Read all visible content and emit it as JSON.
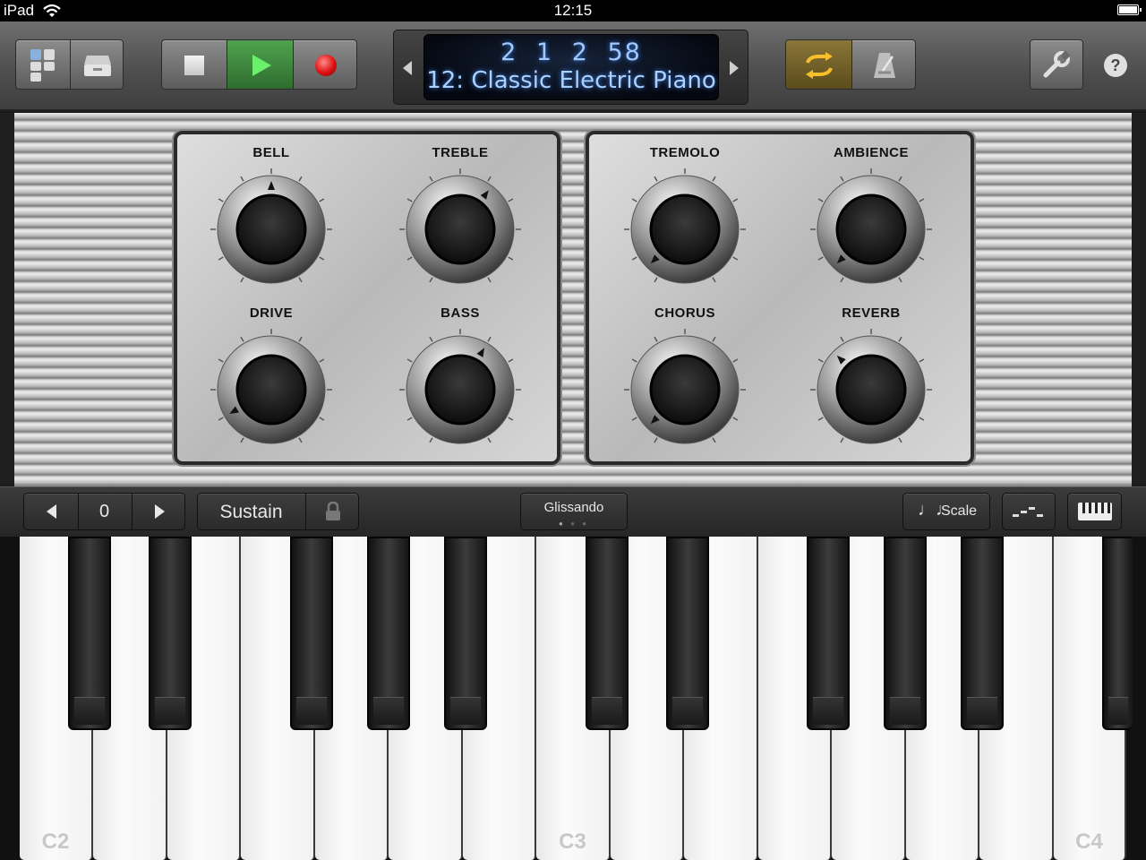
{
  "status_bar": {
    "device": "iPad",
    "time": "12:15"
  },
  "transport": {
    "position": "2 1 2 58",
    "patch_name": "12: Classic Electric Piano",
    "active_color": "#3ea33e",
    "cycle_color": "#f2b51f"
  },
  "knobs": {
    "bell": {
      "label": "BELL",
      "value": 0.5
    },
    "treble": {
      "label": "TREBLE",
      "value": 0.62
    },
    "drive": {
      "label": "DRIVE",
      "value": 0.1
    },
    "bass": {
      "label": "BASS",
      "value": 0.6
    },
    "tremolo": {
      "label": "TREMOLO",
      "value": 0.05
    },
    "ambience": {
      "label": "AMBIENCE",
      "value": 0.05
    },
    "chorus": {
      "label": "CHORUS",
      "value": 0.05
    },
    "reverb": {
      "label": "REVERB",
      "value": 0.35
    }
  },
  "keyboard_bar": {
    "octave_value": "0",
    "sustain_label": "Sustain",
    "glissando_label": "Glissando",
    "scale_label": "Scale"
  },
  "keys": {
    "c2": "C2",
    "c3": "C3",
    "c4": "C4"
  },
  "icons": [
    "wifi-icon",
    "battery-icon",
    "browser-icon",
    "tracks-icon",
    "stop-icon",
    "play-icon",
    "record-icon",
    "cycle-icon",
    "metronome-icon",
    "settings-icon",
    "help-icon",
    "lock-icon",
    "arpeggio-icon",
    "keyboard-icon"
  ]
}
